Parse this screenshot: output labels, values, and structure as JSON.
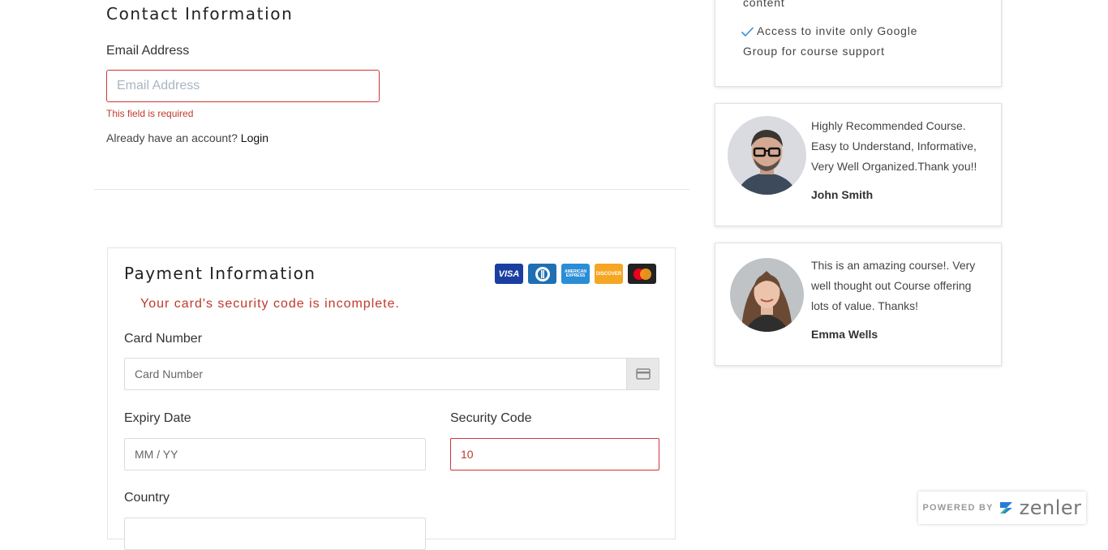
{
  "contact": {
    "title": "Contact Information",
    "email_label": "Email Address",
    "email_placeholder": "Email Address",
    "email_value": "",
    "email_error": "This field is required",
    "already_text": "Already have an account?",
    "login_link": "Login"
  },
  "payment": {
    "title": "Payment Information",
    "error": "Your card's security code is incomplete.",
    "card_brands": [
      "visa-icon",
      "diners-club-icon",
      "american-express-icon",
      "discover-icon",
      "mastercard-icon"
    ],
    "card_brand_labels": {
      "visa": "VISA",
      "amex": "AMERICAN EXPRESS",
      "discover": "DISCOVER"
    },
    "card_number_label": "Card Number",
    "card_number_placeholder": "Card Number",
    "expiry_label": "Expiry Date",
    "expiry_placeholder": "MM / YY",
    "security_label": "Security Code",
    "security_value": "10",
    "country_label": "Country"
  },
  "features": {
    "items": [
      {
        "text": "content",
        "check": false
      },
      {
        "text": "Access to invite only Google",
        "continuation": "Group for course support",
        "check": true
      }
    ]
  },
  "testimonials": [
    {
      "quote": "Highly Recommended Course. Easy to Understand, Informative, Very Well Organized.Thank you!!",
      "author": "John Smith"
    },
    {
      "quote": "This is an amazing course!. Very well thought out Course offering lots of value. Thanks!",
      "author": "Emma Wells"
    }
  ],
  "powered_by": {
    "label": "POWERED BY",
    "brand": "zenler"
  },
  "colors": {
    "error": "#c0392b",
    "error_border": "#d0343a",
    "check": "#3a8fd6"
  }
}
